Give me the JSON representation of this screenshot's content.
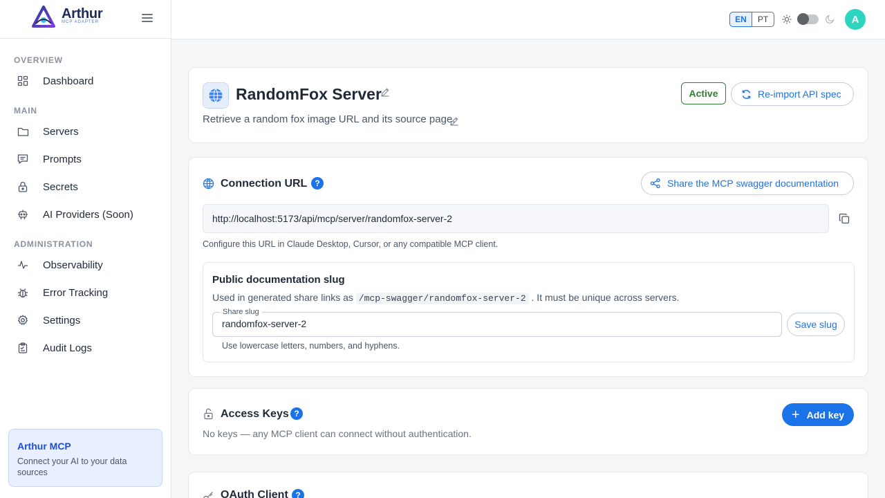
{
  "brand": {
    "name": "Arthur",
    "subtitle": "MCP ADAPTER"
  },
  "sidebar": {
    "sections": [
      {
        "title": "OVERVIEW",
        "items": [
          {
            "label": "Dashboard",
            "icon": "dashboard-icon"
          }
        ]
      },
      {
        "title": "MAIN",
        "items": [
          {
            "label": "Servers",
            "icon": "folder-icon"
          },
          {
            "label": "Prompts",
            "icon": "message-icon"
          },
          {
            "label": "Secrets",
            "icon": "lock-icon"
          },
          {
            "label": "AI Providers (Soon)",
            "icon": "robot-icon"
          }
        ]
      },
      {
        "title": "ADMINISTRATION",
        "items": [
          {
            "label": "Observability",
            "icon": "activity-icon"
          },
          {
            "label": "Error Tracking",
            "icon": "bug-icon"
          },
          {
            "label": "Settings",
            "icon": "gear-icon"
          },
          {
            "label": "Audit Logs",
            "icon": "clipboard-icon"
          }
        ]
      }
    ],
    "promo": {
      "title": "Arthur MCP",
      "description": "Connect your AI to your data sources"
    }
  },
  "topbar": {
    "languages": [
      "EN",
      "PT"
    ],
    "active_language": "EN",
    "theme_dark": false,
    "avatar_initial": "A"
  },
  "server": {
    "name": "RandomFox Server",
    "description": "Retrieve a random fox image URL and its source page.",
    "status": "Active",
    "reimport_label": "Re-import API spec"
  },
  "connection": {
    "title": "Connection URL",
    "share_label": "Share the MCP swagger documentation",
    "url": "http://localhost:5173/api/mcp/server/randomfox-server-2",
    "hint": "Configure this URL in Claude Desktop, Cursor, or any compatible MCP client.",
    "slug": {
      "title": "Public documentation slug",
      "desc_before": "Used in generated share links as",
      "desc_code": "/mcp-swagger/randomfox-server-2",
      "desc_after": ". It must be unique across servers.",
      "field_label": "Share slug",
      "value": "randomfox-server-2",
      "helper": "Use lowercase letters, numbers, and hyphens.",
      "save_label": "Save slug"
    }
  },
  "access_keys": {
    "title": "Access Keys",
    "description": "No keys — any MCP client can connect without authentication.",
    "add_label": "Add key"
  },
  "oauth": {
    "title": "OAuth Client"
  },
  "colors": {
    "accent": "#1a73e8",
    "active": "#2e7d32",
    "avatar": "#2dd4bf"
  }
}
